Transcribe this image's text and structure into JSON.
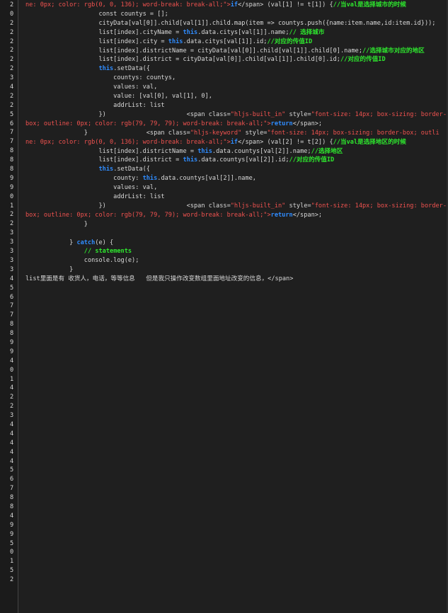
{
  "gutter_numbers": [
    "2",
    "0",
    "2",
    "2",
    "2",
    "2",
    "2",
    "2",
    "3",
    "4",
    "2",
    "2",
    "5",
    "6",
    "7",
    "7",
    "8",
    "8",
    "8",
    "9",
    "9",
    "0",
    "1",
    "2",
    "2",
    "3",
    "3",
    "3",
    "3",
    "3",
    "4",
    "5",
    "6",
    "7",
    "7",
    "8",
    "8",
    "9",
    "9",
    "4",
    "0",
    "1",
    "4",
    "2",
    "2",
    "3",
    "4",
    "4",
    "4",
    "4",
    "4",
    "5",
    "6",
    "7",
    "8",
    "8",
    "4",
    "9",
    "9",
    "5",
    "0",
    "1",
    "5",
    "2"
  ],
  "code_lines": [
    [
      {
        "t": "str",
        "v": "ne: 0px; color: rgb(0, 0, 136); word-break: break-all;\">"
      },
      {
        "t": "kw",
        "v": "if"
      },
      {
        "t": "plain",
        "v": "</span> (val[1] != t[1]) {"
      },
      {
        "t": "cm",
        "v": "//当val是选择城市的时候"
      }
    ],
    [
      {
        "t": "plain",
        "v": "                    const countys = [];"
      }
    ],
    [
      {
        "t": "plain",
        "v": "                    cityData[val[0]].child[val[1]].child.map(item => countys.push({name:item.name,id:item.id}));"
      }
    ],
    [
      {
        "t": "plain",
        "v": "                    list[index].cityName = "
      },
      {
        "t": "kw",
        "v": "this"
      },
      {
        "t": "plain",
        "v": ".data.citys[val[1]].name;"
      },
      {
        "t": "cm",
        "v": "// 选择城市"
      }
    ],
    [
      {
        "t": "plain",
        "v": "                    list[index].city = "
      },
      {
        "t": "kw",
        "v": "this"
      },
      {
        "t": "plain",
        "v": ".data.citys[val[1]].id;"
      },
      {
        "t": "cm",
        "v": "//对应的传值ID"
      }
    ],
    [
      {
        "t": "plain",
        "v": "                    list[index].districtName = cityData[val[0]].child[val[1]].child[0].name;"
      },
      {
        "t": "cm",
        "v": "//选择城市对应的地区"
      }
    ],
    [
      {
        "t": "plain",
        "v": "                    list[index].district = cityData[val[0]].child[val[1]].child[0].id;"
      },
      {
        "t": "cm",
        "v": "//对应的传值ID"
      }
    ],
    [
      {
        "t": "plain",
        "v": "                    "
      },
      {
        "t": "kw",
        "v": "this"
      },
      {
        "t": "plain",
        "v": ".setData({"
      }
    ],
    [
      {
        "t": "plain",
        "v": "                        countys: countys,"
      }
    ],
    [
      {
        "t": "plain",
        "v": "                        values: val,"
      }
    ],
    [
      {
        "t": "plain",
        "v": "                        value: [val[0], val[1], 0],"
      }
    ],
    [
      {
        "t": "plain",
        "v": "                        addrList: list"
      }
    ],
    [
      {
        "t": "plain",
        "v": "                    })                      <span class="
      },
      {
        "t": "str",
        "v": "\"hljs-built_in\""
      },
      {
        "t": "plain",
        "v": " style="
      },
      {
        "t": "str",
        "v": "\"font-size: 14px; box-sizing: border-"
      }
    ],
    [
      {
        "t": "str",
        "v": "box; outline: 0px; color: rgb(79, 79, 79); word-break: break-all;\">"
      },
      {
        "t": "kw",
        "v": "return"
      },
      {
        "t": "plain",
        "v": "</span>;"
      }
    ],
    [
      {
        "t": "plain",
        "v": "                }                <span class="
      },
      {
        "t": "str",
        "v": "\"hljs-keyword\""
      },
      {
        "t": "plain",
        "v": " style="
      },
      {
        "t": "str",
        "v": "\"font-size: 14px; box-sizing: border-box; outli"
      }
    ],
    [
      {
        "t": "str",
        "v": "ne: 0px; color: rgb(0, 0, 136); word-break: break-all;\">"
      },
      {
        "t": "kw",
        "v": "if"
      },
      {
        "t": "plain",
        "v": "</span> (val[2] != t[2]) {"
      },
      {
        "t": "cm",
        "v": "//当val是选择地区的时候"
      }
    ],
    [
      {
        "t": "plain",
        "v": "                    list[index].districtName = "
      },
      {
        "t": "kw",
        "v": "this"
      },
      {
        "t": "plain",
        "v": ".data.countys[val[2]].name;"
      },
      {
        "t": "cm",
        "v": "//选择地区"
      }
    ],
    [
      {
        "t": "plain",
        "v": "                    list[index].district = "
      },
      {
        "t": "kw",
        "v": "this"
      },
      {
        "t": "plain",
        "v": ".data.countys[val[2]].id;"
      },
      {
        "t": "cm",
        "v": "//对应的传值ID"
      }
    ],
    [
      {
        "t": "plain",
        "v": "                    "
      },
      {
        "t": "kw",
        "v": "this"
      },
      {
        "t": "plain",
        "v": ".setData({"
      }
    ],
    [
      {
        "t": "plain",
        "v": "                        county: "
      },
      {
        "t": "kw",
        "v": "this"
      },
      {
        "t": "plain",
        "v": ".data.countys[val[2]].name,"
      }
    ],
    [
      {
        "t": "plain",
        "v": "                        values: val,"
      }
    ],
    [
      {
        "t": "plain",
        "v": "                        addrList: list"
      }
    ],
    [
      {
        "t": "plain",
        "v": "                    })                      <span class="
      },
      {
        "t": "str",
        "v": "\"hljs-built_in\""
      },
      {
        "t": "plain",
        "v": " style="
      },
      {
        "t": "str",
        "v": "\"font-size: 14px; box-sizing: border-"
      }
    ],
    [
      {
        "t": "str",
        "v": "box; outline: 0px; color: rgb(79, 79, 79); word-break: break-all;\">"
      },
      {
        "t": "kw",
        "v": "return"
      },
      {
        "t": "plain",
        "v": "</span>;"
      }
    ],
    [
      {
        "t": "plain",
        "v": "                }"
      }
    ],
    [
      {
        "t": "plain",
        "v": ""
      }
    ],
    [
      {
        "t": "plain",
        "v": "            } "
      },
      {
        "t": "kw",
        "v": "catch"
      },
      {
        "t": "plain",
        "v": "(e) {"
      }
    ],
    [
      {
        "t": "plain",
        "v": "                "
      },
      {
        "t": "cm",
        "v": "// statements"
      }
    ],
    [
      {
        "t": "plain",
        "v": "                console.log(e);"
      }
    ],
    [
      {
        "t": "plain",
        "v": "            }"
      }
    ],
    [
      {
        "t": "plain",
        "v": "list里面是有 收货人，电话，等等信息   但是我只操作改变数组里面地址改变的信息，</span>"
      }
    ]
  ]
}
